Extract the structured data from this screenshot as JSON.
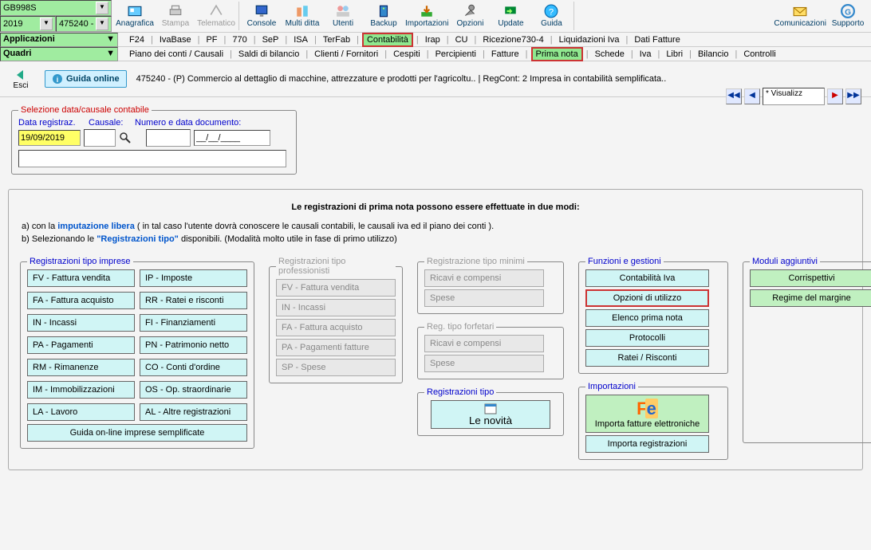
{
  "selects": {
    "company": "GB998S",
    "year": "2019",
    "code": "475240 -"
  },
  "apps_label": "Applicazioni",
  "quadri_label": "Quadri",
  "toolbar": {
    "anagrafica": "Anagrafica",
    "stampa": "Stampa",
    "telematico": "Telematico",
    "console": "Console",
    "multiditta": "Multi ditta",
    "utenti": "Utenti",
    "backup": "Backup",
    "importazioni": "Importazioni",
    "opzioni": "Opzioni",
    "update": "Update",
    "guida": "Guida",
    "comunicazioni": "Comunicazioni",
    "supporto": "Supporto"
  },
  "tabs1": [
    "F24",
    "IvaBase",
    "PF",
    "770",
    "SeP",
    "ISA",
    "TerFab",
    "Contabilità",
    "Irap",
    "CU",
    "Ricezione730-4",
    "Liquidazioni Iva",
    "Dati Fatture"
  ],
  "tabs1_active": 7,
  "tabs2": [
    "Piano dei conti / Causali",
    "Saldi di bilancio",
    "Clienti / Fornitori",
    "Cespiti",
    "Percipienti",
    "Fatture",
    "Prima nota",
    "Schede",
    "Iva",
    "Libri",
    "Bilancio",
    "Controlli"
  ],
  "tabs2_active": 6,
  "esci": "Esci",
  "guida_online": "Guida online",
  "record_text": "475240 - (P) Commercio al dettaglio di macchine, attrezzature e prodotti per l'agricoltu.. | RegCont: 2 Impresa  in contabilità semplificata..",
  "nav_display": "* Visualizz",
  "sel": {
    "legend": "Selezione data/causale contabile",
    "datareg": "Data registraz.",
    "causale": "Causale:",
    "numdata": "Numero e data documento:",
    "data_val": "19/09/2019",
    "doc_date": "__/__/____"
  },
  "instr_title": "Le registrazioni di prima nota possono essere effettuate in due modi:",
  "instr_a_pre": "a) con la  ",
  "instr_a_link": "imputazione libera",
  "instr_a_post": " ( in tal caso l'utente dovrà conoscere le causali contabili, le causali iva ed il piano dei conti ).",
  "instr_b_pre": "b) Selezionando le  ",
  "instr_b_link": "\"Registrazioni tipo\"",
  "instr_b_post": " disponibili. (Modalità molto utile in fase di primo utilizzo)",
  "group1": {
    "legend": "Registrazioni tipo imprese",
    "left": [
      "FV - Fattura vendita",
      "FA - Fattura acquisto",
      "IN - Incassi",
      "PA - Pagamenti",
      "RM - Rimanenze",
      "IM - Immobilizzazioni",
      "LA - Lavoro"
    ],
    "right": [
      "IP - Imposte",
      "RR - Ratei e risconti",
      "FI - Finanziamenti",
      "PN - Patrimonio netto",
      "CO - Conti d'ordine",
      "OS - Op. straordinarie",
      "AL - Altre registrazioni"
    ],
    "guida": "Guida on-line imprese semplificate"
  },
  "group2": {
    "legend": "Registrazioni tipo professionisti",
    "items": [
      "FV - Fattura vendita",
      "IN - Incassi",
      "FA - Fattura acquisto",
      "PA - Pagamenti fatture",
      "SP - Spese"
    ]
  },
  "group3": {
    "legend": "Registrazione tipo minimi",
    "items": [
      "Ricavi e compensi",
      "Spese"
    ]
  },
  "group3b": {
    "legend": "Reg. tipo forfetari",
    "items": [
      "Ricavi e compensi",
      "Spese"
    ]
  },
  "group3c": {
    "legend": "Registrazioni tipo",
    "novita": "Le novità"
  },
  "group4": {
    "legend": "Funzioni e gestioni",
    "items": [
      "Contabilità Iva",
      "Opzioni di utilizzo",
      "Elenco prima nota",
      "Protocolli",
      "Ratei / Risconti"
    ],
    "hl_index": 1
  },
  "group4b": {
    "legend": "Importazioni",
    "importa_fe": "Importa fatture elettroniche",
    "importa_reg": "Importa registrazioni"
  },
  "group5": {
    "legend": "Moduli aggiuntivi",
    "items": [
      "Corrispettivi",
      "Regime del margine"
    ]
  }
}
